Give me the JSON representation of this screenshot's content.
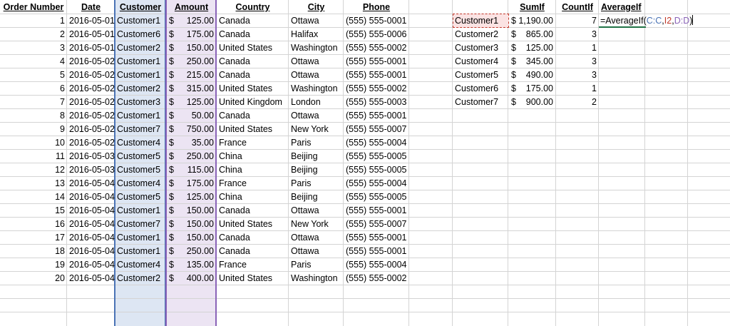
{
  "headers": {
    "order_number": "Order Number",
    "date": "Date",
    "customer": "Customer",
    "amount": "Amount",
    "country": "Country",
    "city": "City",
    "phone": "Phone",
    "sumif": "SumIf",
    "countif": "CountIf",
    "averageif": "AverageIf"
  },
  "orders": [
    {
      "n": "1",
      "date": "2016-05-01",
      "customer": "Customer1",
      "amount": "125.00",
      "country": "Canada",
      "city": "Ottawa",
      "phone": "(555) 555-0001"
    },
    {
      "n": "2",
      "date": "2016-05-01",
      "customer": "Customer6",
      "amount": "175.00",
      "country": "Canada",
      "city": "Halifax",
      "phone": "(555) 555-0006"
    },
    {
      "n": "3",
      "date": "2016-05-01",
      "customer": "Customer2",
      "amount": "150.00",
      "country": "United States",
      "city": "Washington",
      "phone": "(555) 555-0002"
    },
    {
      "n": "4",
      "date": "2016-05-02",
      "customer": "Customer1",
      "amount": "250.00",
      "country": "Canada",
      "city": "Ottawa",
      "phone": "(555) 555-0001"
    },
    {
      "n": "5",
      "date": "2016-05-02",
      "customer": "Customer1",
      "amount": "215.00",
      "country": "Canada",
      "city": "Ottawa",
      "phone": "(555) 555-0001"
    },
    {
      "n": "6",
      "date": "2016-05-02",
      "customer": "Customer2",
      "amount": "315.00",
      "country": "United States",
      "city": "Washington",
      "phone": "(555) 555-0002"
    },
    {
      "n": "7",
      "date": "2016-05-02",
      "customer": "Customer3",
      "amount": "125.00",
      "country": "United Kingdom",
      "city": "London",
      "phone": "(555) 555-0003"
    },
    {
      "n": "8",
      "date": "2016-05-02",
      "customer": "Customer1",
      "amount": "50.00",
      "country": "Canada",
      "city": "Ottawa",
      "phone": "(555) 555-0001"
    },
    {
      "n": "9",
      "date": "2016-05-02",
      "customer": "Customer7",
      "amount": "750.00",
      "country": "United States",
      "city": "New York",
      "phone": "(555) 555-0007"
    },
    {
      "n": "10",
      "date": "2016-05-02",
      "customer": "Customer4",
      "amount": "35.00",
      "country": "France",
      "city": "Paris",
      "phone": "(555) 555-0004"
    },
    {
      "n": "11",
      "date": "2016-05-03",
      "customer": "Customer5",
      "amount": "250.00",
      "country": "China",
      "city": "Beijing",
      "phone": "(555) 555-0005"
    },
    {
      "n": "12",
      "date": "2016-05-03",
      "customer": "Customer5",
      "amount": "115.00",
      "country": "China",
      "city": "Beijing",
      "phone": "(555) 555-0005"
    },
    {
      "n": "13",
      "date": "2016-05-04",
      "customer": "Customer4",
      "amount": "175.00",
      "country": "France",
      "city": "Paris",
      "phone": "(555) 555-0004"
    },
    {
      "n": "14",
      "date": "2016-05-04",
      "customer": "Customer5",
      "amount": "125.00",
      "country": "China",
      "city": "Beijing",
      "phone": "(555) 555-0005"
    },
    {
      "n": "15",
      "date": "2016-05-04",
      "customer": "Customer1",
      "amount": "150.00",
      "country": "Canada",
      "city": "Ottawa",
      "phone": "(555) 555-0001"
    },
    {
      "n": "16",
      "date": "2016-05-04",
      "customer": "Customer7",
      "amount": "150.00",
      "country": "United States",
      "city": "New York",
      "phone": "(555) 555-0007"
    },
    {
      "n": "17",
      "date": "2016-05-04",
      "customer": "Customer1",
      "amount": "150.00",
      "country": "Canada",
      "city": "Ottawa",
      "phone": "(555) 555-0001"
    },
    {
      "n": "18",
      "date": "2016-05-04",
      "customer": "Customer1",
      "amount": "250.00",
      "country": "Canada",
      "city": "Ottawa",
      "phone": "(555) 555-0001"
    },
    {
      "n": "19",
      "date": "2016-05-04",
      "customer": "Customer4",
      "amount": "135.00",
      "country": "France",
      "city": "Paris",
      "phone": "(555) 555-0004"
    },
    {
      "n": "20",
      "date": "2016-05-04",
      "customer": "Customer2",
      "amount": "400.00",
      "country": "United States",
      "city": "Washington",
      "phone": "(555) 555-0002"
    }
  ],
  "summary": [
    {
      "customer": "Customer1",
      "sumif": "1,190.00",
      "countif": "7"
    },
    {
      "customer": "Customer2",
      "sumif": "865.00",
      "countif": "3"
    },
    {
      "customer": "Customer3",
      "sumif": "125.00",
      "countif": "1"
    },
    {
      "customer": "Customer4",
      "sumif": "345.00",
      "countif": "3"
    },
    {
      "customer": "Customer5",
      "sumif": "490.00",
      "countif": "3"
    },
    {
      "customer": "Customer6",
      "sumif": "175.00",
      "countif": "1"
    },
    {
      "customer": "Customer7",
      "sumif": "900.00",
      "countif": "2"
    }
  ],
  "currency_symbol": "$",
  "formula": {
    "prefix": "=AverageIf(",
    "range1": "C:C",
    "sep1": ",",
    "criteria": "I2",
    "sep2": ",",
    "range2": "D:D",
    "suffix": ")"
  },
  "colors": {
    "customer_range": "#4a73b5",
    "criteria_cell": "#c0392b",
    "amount_range": "#8a63b8",
    "active_cell": "#217346"
  }
}
